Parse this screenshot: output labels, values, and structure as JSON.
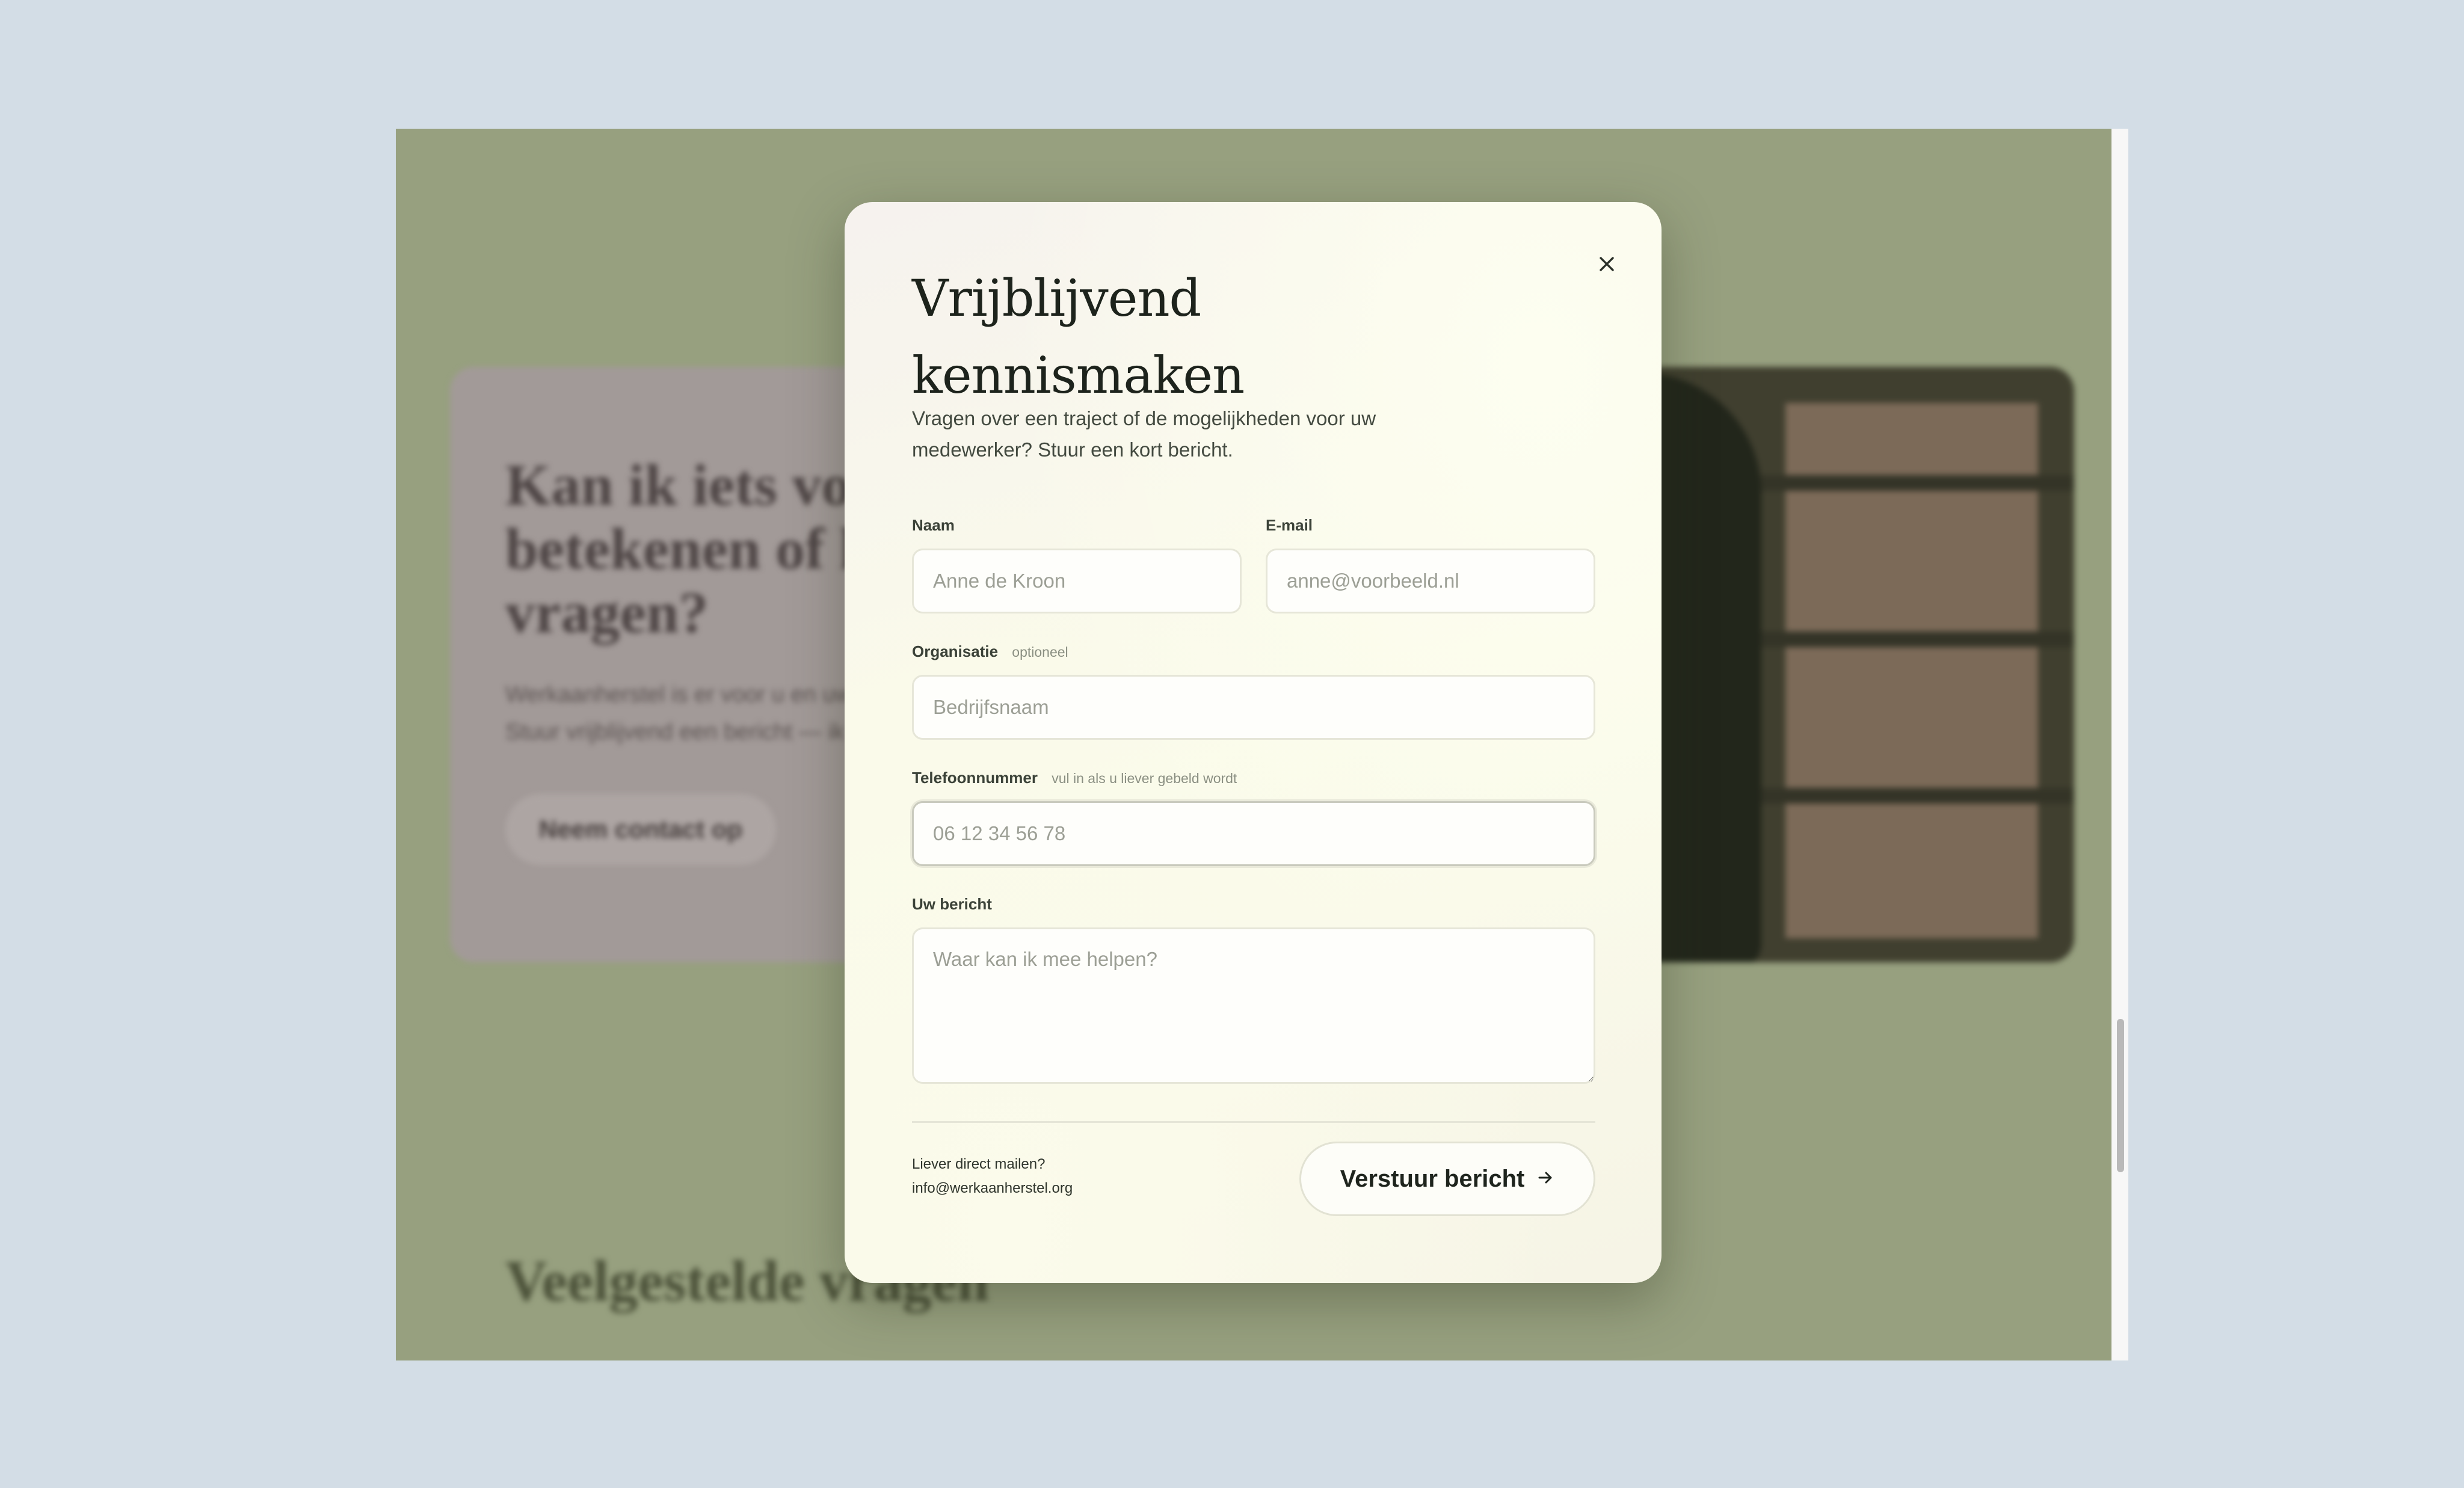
{
  "background_page": {
    "card_heading": "Kan ik iets voor u betekenen of heeft u vragen?",
    "card_text": "Werkaanherstel is er voor u en uw medewerker. Stuur vrijblijvend een bericht — ik denk graag mee.",
    "card_button": "Neem contact op",
    "faq_heading": "Veelgestelde vragen"
  },
  "modal": {
    "title": "Vrijblijvend\nkennismaken",
    "intro": "Vragen over een traject of de mogelijkheden voor uw medewerker? Stuur een kort bericht.",
    "fields": {
      "name": {
        "label": "Naam",
        "placeholder": "Anne de Kroon"
      },
      "email": {
        "label": "E-mail",
        "placeholder": "anne@voorbeeld.nl"
      },
      "organization": {
        "label": "Organisatie",
        "hint": "optioneel",
        "placeholder": "Bedrijfsnaam"
      },
      "phone": {
        "label": "Telefoonnummer",
        "hint": "vul in als u liever gebeld wordt",
        "placeholder": "06 12 34 56 78"
      },
      "message": {
        "label": "Uw bericht",
        "placeholder": "Waar kan ik mee helpen?"
      }
    },
    "footer": {
      "mail_prompt": "Liever direct mailen?",
      "mail_address": "info@werkaanherstel.org"
    },
    "submit_label": "Verstuur bericht",
    "icons": {
      "close": "close-icon",
      "submit_arrow": "arrow-right-icon"
    }
  }
}
